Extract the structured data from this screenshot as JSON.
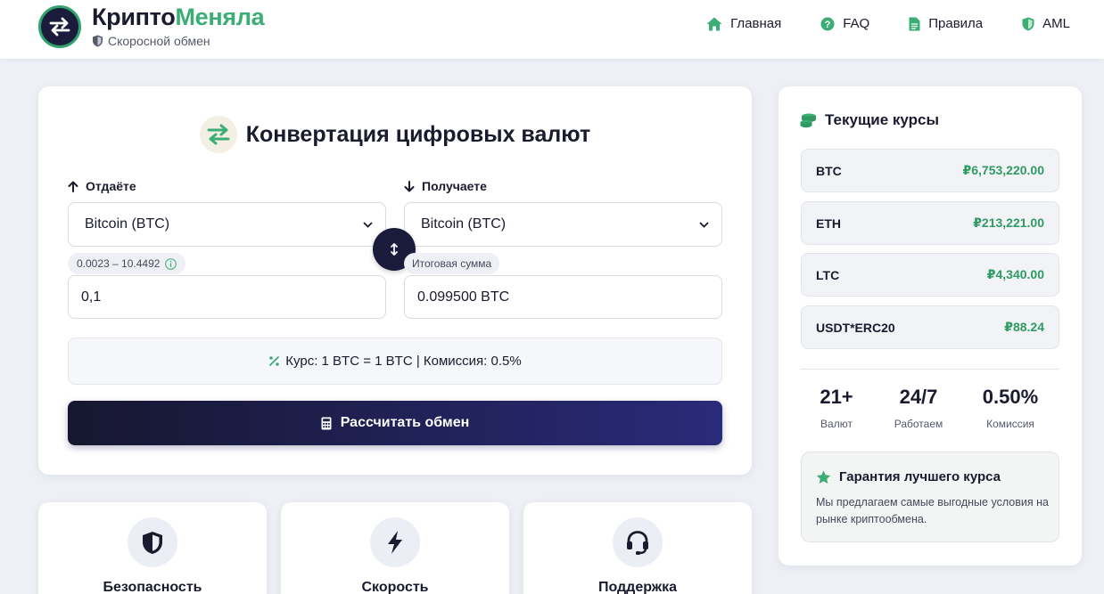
{
  "header": {
    "brand_part1": "Крипто",
    "brand_part2": "Меняла",
    "tagline": "Скоросной обмен",
    "nav": [
      {
        "label": "Главная",
        "icon": "home-icon"
      },
      {
        "label": "FAQ",
        "icon": "question-circle-icon"
      },
      {
        "label": "Правила",
        "icon": "document-icon"
      },
      {
        "label": "AML",
        "icon": "shield-icon"
      }
    ]
  },
  "converter": {
    "title": "Конвертация цифровых валют",
    "give_label": "Отдаёте",
    "get_label": "Получаете",
    "give_currency": "Bitcoin (BTC)",
    "get_currency": "Bitcoin (BTC)",
    "range": "0.0023 – 10.4492",
    "result_label": "Итоговая сумма",
    "amount_value": "0,1",
    "result_value": "0.099500 BTC",
    "rate_info": "Курс: 1 BTC = 1 BTC | Комиссия: 0.5%",
    "calc_button": "Рассчитать обмен"
  },
  "features": [
    {
      "title": "Безопасность",
      "icon": "shield-icon"
    },
    {
      "title": "Скорость",
      "icon": "bolt-icon"
    },
    {
      "title": "Поддержка",
      "icon": "headset-icon"
    }
  ],
  "rates": {
    "title": "Текущие курсы",
    "items": [
      {
        "code": "BTC",
        "price": "₽6,753,220.00"
      },
      {
        "code": "ETH",
        "price": "₽213,221.00"
      },
      {
        "code": "LTC",
        "price": "₽4,340.00"
      },
      {
        "code": "USDT*ERC20",
        "price": "₽88.24"
      }
    ],
    "stats": [
      {
        "value": "21+",
        "label": "Валют"
      },
      {
        "value": "24/7",
        "label": "Работаем"
      },
      {
        "value": "0.50%",
        "label": "Комиссия"
      }
    ],
    "guarantee_title": "Гарантия лучшего курса",
    "guarantee_text": "Мы предлагаем самые выгодные условия на рынке криптообмена."
  },
  "colors": {
    "accent_green": "#3aae74",
    "price_green": "#2f9a62",
    "dark_navy": "#1b1c3c",
    "button_gradient_end": "#2a2a7a",
    "background": "#eef0f6"
  }
}
